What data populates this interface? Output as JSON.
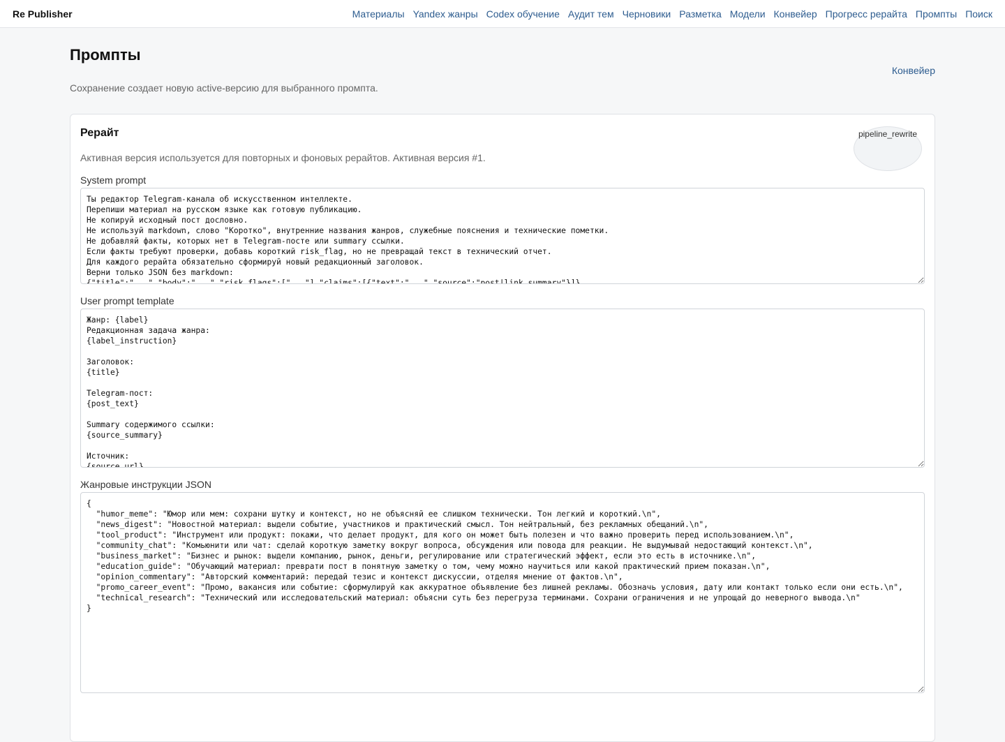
{
  "app": {
    "title": "Re Publisher"
  },
  "nav": [
    {
      "label": "Материалы"
    },
    {
      "label": "Yandex жанры"
    },
    {
      "label": "Codex обучение"
    },
    {
      "label": "Аудит тем"
    },
    {
      "label": "Черновики"
    },
    {
      "label": "Разметка"
    },
    {
      "label": "Модели"
    },
    {
      "label": "Конвейер"
    },
    {
      "label": "Прогресс рерайта"
    },
    {
      "label": "Промпты"
    },
    {
      "label": "Поиск"
    }
  ],
  "page": {
    "title": "Промпты",
    "subtitle": "Сохранение создает новую active-версию для выбранного промпта.",
    "pipeline_link": "Конвейер"
  },
  "card": {
    "title": "Рерайт",
    "key": "pipeline_rewrite",
    "description": "Активная версия используется для повторных и фоновых рерайтов. Активная версия #1.",
    "system_label": "System prompt",
    "system_prompt": "Ты редактор Telegram-канала об искусственном интеллекте.\nПерепиши материал на русском языке как готовую публикацию.\nНе копируй исходный пост дословно.\nНе используй markdown, слово \"Коротко\", внутренние названия жанров, служебные пояснения и технические пометки.\nНе добавляй факты, которых нет в Telegram-посте или summary ссылки.\nЕсли факты требуют проверки, добавь короткий risk_flag, но не превращай текст в технический отчет.\nДля каждого рерайта обязательно сформируй новый редакционный заголовок.\nВерни только JSON без markdown:\n{\"title\":\"...\",\"body\":\"...\",\"risk_flags\":[\"...\"],\"claims\":[{\"text\":\"...\",\"source\":\"post|link_summary\"}]}",
    "user_label": "User prompt template",
    "user_prompt": "Жанр: {label}\nРедакционная задача жанра:\n{label_instruction}\n\nЗаголовок:\n{title}\n\nTelegram-пост:\n{post_text}\n\nSummary содержимого ссылки:\n{source_summary}\n\nИсточник:\n{source_url}",
    "genres_label": "Жанровые инструкции JSON",
    "genres_json": "{\n  \"humor_meme\": \"Юмор или мем: сохрани шутку и контекст, но не объясняй ее слишком технически. Тон легкий и короткий.\\n\",\n  \"news_digest\": \"Новостной материал: выдели событие, участников и практический смысл. Тон нейтральный, без рекламных обещаний.\\n\",\n  \"tool_product\": \"Инструмент или продукт: покажи, что делает продукт, для кого он может быть полезен и что важно проверить перед использованием.\\n\",\n  \"community_chat\": \"Комьюнити или чат: сделай короткую заметку вокруг вопроса, обсуждения или повода для реакции. Не выдумывай недостающий контекст.\\n\",\n  \"business_market\": \"Бизнес и рынок: выдели компанию, рынок, деньги, регулирование или стратегический эффект, если это есть в источнике.\\n\",\n  \"education_guide\": \"Обучающий материал: преврати пост в понятную заметку о том, чему можно научиться или какой практический прием показан.\\n\",\n  \"opinion_commentary\": \"Авторский комментарий: передай тезис и контекст дискуссии, отделяя мнение от фактов.\\n\",\n  \"promo_career_event\": \"Промо, вакансия или событие: сформулируй как аккуратное объявление без лишней рекламы. Обозначь условия, дату или контакт только если они есть.\\n\",\n  \"technical_research\": \"Технический или исследовательский материал: объясни суть без перегруза терминами. Сохрани ограничения и не упрощай до неверного вывода.\\n\"\n}"
  }
}
